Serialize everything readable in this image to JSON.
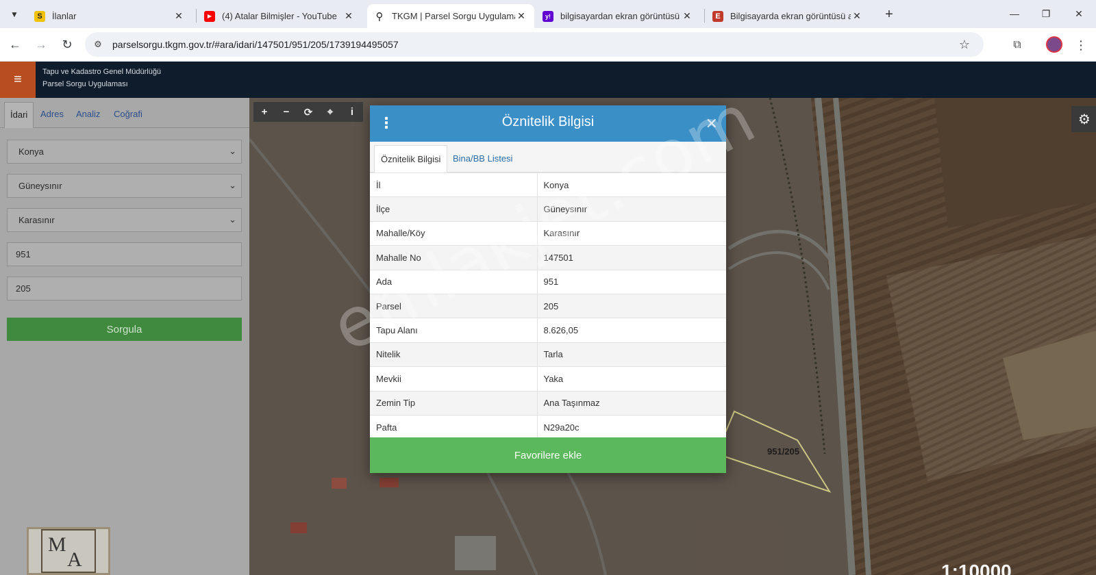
{
  "browser": {
    "tabs": [
      {
        "title": "İlanlar",
        "favicon": "S",
        "favicon_color": "#f2c200"
      },
      {
        "title": "(4) Atalar Bilmişler - YouTube",
        "favicon": "▶",
        "favicon_color": "#ff0000"
      },
      {
        "title": "TKGM | Parsel Sorgu Uygulamas",
        "favicon": "⚲",
        "favicon_color": "#222222"
      },
      {
        "title": "bilgisayardan ekran görüntüsü a",
        "favicon": "y!",
        "favicon_color": "#6001d2"
      },
      {
        "title": "Bilgisayarda ekran görüntüsü al",
        "favicon": "E",
        "favicon_color": "#c0392b"
      }
    ],
    "url": "parselsorgu.tkgm.gov.tr/#ara/idari/147501/951/205/1739194495057"
  },
  "app": {
    "org": "Tapu ve Kadastro Genel Müdürlüğü",
    "name": "Parsel Sorgu Uygulaması",
    "header_color": "#0f1c2b",
    "accent": "#b84d1f"
  },
  "left_panel": {
    "tabs": [
      "İdari",
      "Adres",
      "Analiz",
      "Coğrafi"
    ],
    "active_tab": "İdari",
    "il": "Konya",
    "ilce": "Güneysınır",
    "mahalle": "Karasınır",
    "ada": "951",
    "parsel": "205",
    "button": "Sorgula"
  },
  "map": {
    "parcel_label": "951/205",
    "scale_text": "1:10000"
  },
  "modal": {
    "title": "Öznitelik Bilgisi",
    "tabs": [
      "Öznitelik Bilgisi",
      "Bina/BB Listesi"
    ],
    "rows": [
      {
        "key": "İl",
        "value": "Konya"
      },
      {
        "key": "İlçe",
        "value": "Güneysınır"
      },
      {
        "key": "Mahalle/Köy",
        "value": "Karasınır"
      },
      {
        "key": "Mahalle No",
        "value": "147501"
      },
      {
        "key": "Ada",
        "value": "951"
      },
      {
        "key": "Parsel",
        "value": "205"
      },
      {
        "key": "Tapu Alanı",
        "value": "8.626,05"
      },
      {
        "key": "Nitelik",
        "value": "Tarla"
      },
      {
        "key": "Mevkii",
        "value": "Yaka"
      },
      {
        "key": "Zemin Tip",
        "value": "Ana Taşınmaz"
      },
      {
        "key": "Pafta",
        "value": "N29a20c"
      }
    ],
    "favorite_button": "Favorilere ekle",
    "header_color": "#3b8fc7",
    "button_color": "#5cb85c"
  },
  "logo": {
    "line1": "M",
    "line2": "A"
  },
  "watermark": "emlakjet.com"
}
